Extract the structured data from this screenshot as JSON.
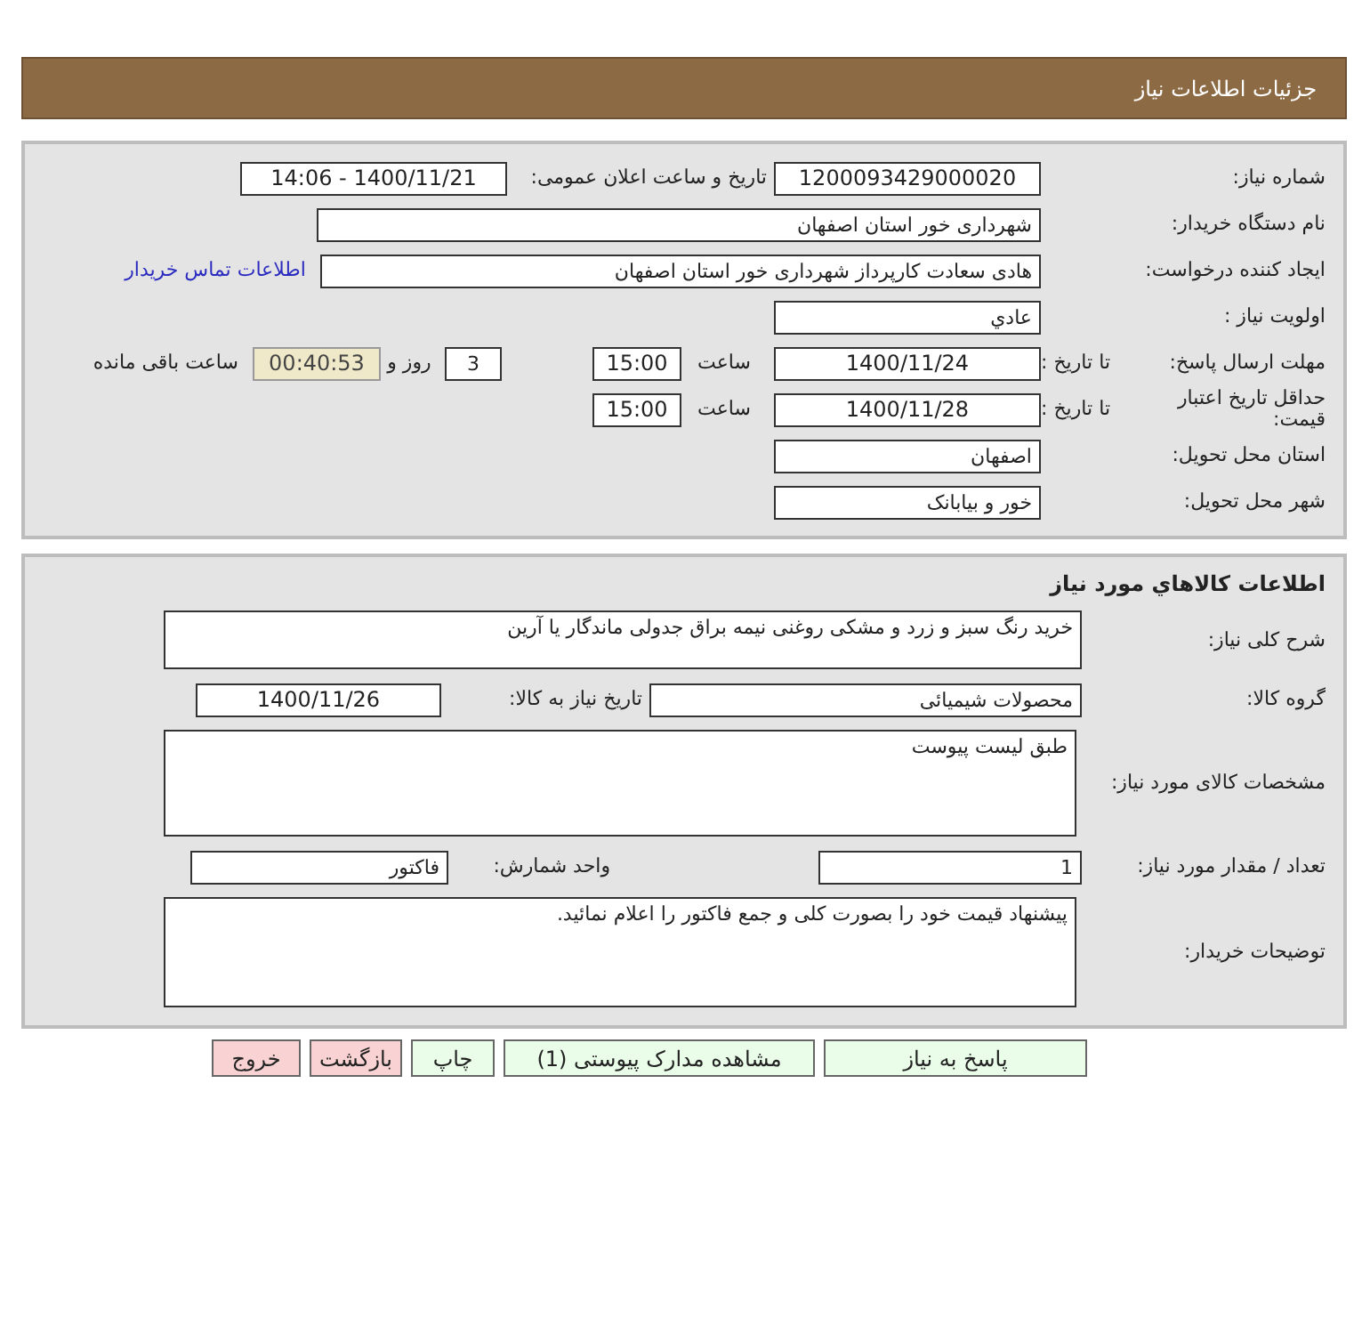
{
  "header": {
    "title": "جزئیات اطلاعات نیاز"
  },
  "need_details": {
    "need_number": {
      "label": "شماره نیاز:",
      "value": "1200093429000020"
    },
    "announced": {
      "label": "تاریخ و ساعت اعلان عمومی:",
      "value": "1400/11/21 - 14:06"
    },
    "buyer_org": {
      "label": "نام دستگاه خریدار:",
      "value": "شهرداری خور استان اصفهان"
    },
    "requester": {
      "label": "ایجاد کننده درخواست:",
      "value": "هادی سعادت کارپرداز شهرداری خور استان اصفهان",
      "contact_link": "اطلاعات تماس خریدار"
    },
    "priority": {
      "label": "اولویت نیاز :",
      "value": "عادي"
    },
    "reply_deadline": {
      "label": "مهلت ارسال پاسخ:",
      "date_label": "تا تاریخ :",
      "date": "1400/11/24",
      "time_label": "ساعت",
      "time": "15:00",
      "days": "3",
      "days_label": "روز و",
      "remaining": "00:40:53",
      "remaining_label": "ساعت باقی مانده"
    },
    "price_validity": {
      "label": "حداقل تاریخ اعتبار قیمت:",
      "date_label": "تا تاریخ :",
      "date": "1400/11/28",
      "time_label": "ساعت",
      "time": "15:00"
    },
    "province": {
      "label": "استان محل تحویل:",
      "value": "اصفهان"
    },
    "city": {
      "label": "شهر محل تحویل:",
      "value": "خور و بیابانک"
    }
  },
  "goods": {
    "title": "اطلاعات كالاهاي مورد نياز",
    "description": {
      "label": "شرح کلی نیاز:",
      "value": "خرید رنگ سبز و زرد و مشکی روغنی نیمه براق جدولی ماندگار یا آرین"
    },
    "category": {
      "label": "گروه کالا:",
      "value": "محصولات شیمیائی"
    },
    "need_date": {
      "label": "تاریخ نیاز به کالا:",
      "value": "1400/11/26"
    },
    "specs": {
      "label": "مشخصات کالای مورد نیاز:",
      "value": "طبق لیست پیوست"
    },
    "quantity": {
      "label": "تعداد / مقدار مورد نیاز:",
      "value": "1"
    },
    "unit": {
      "label": "واحد شمارش:",
      "value": "فاکتور"
    },
    "buyer_notes": {
      "label": "توضیحات خریدار:",
      "value": "پیشنهاد قیمت خود را بصورت کلی و جمع فاکتور را اعلام نمائید."
    }
  },
  "buttons": [
    {
      "label": "پاسخ به نیاز",
      "kind": "normal"
    },
    {
      "label": "مشاهده مدارک پیوستی (1)",
      "kind": "normal"
    },
    {
      "label": "چاپ",
      "kind": "normal"
    },
    {
      "label": "بازگشت",
      "kind": "warning"
    },
    {
      "label": "خروج",
      "kind": "warning"
    }
  ]
}
